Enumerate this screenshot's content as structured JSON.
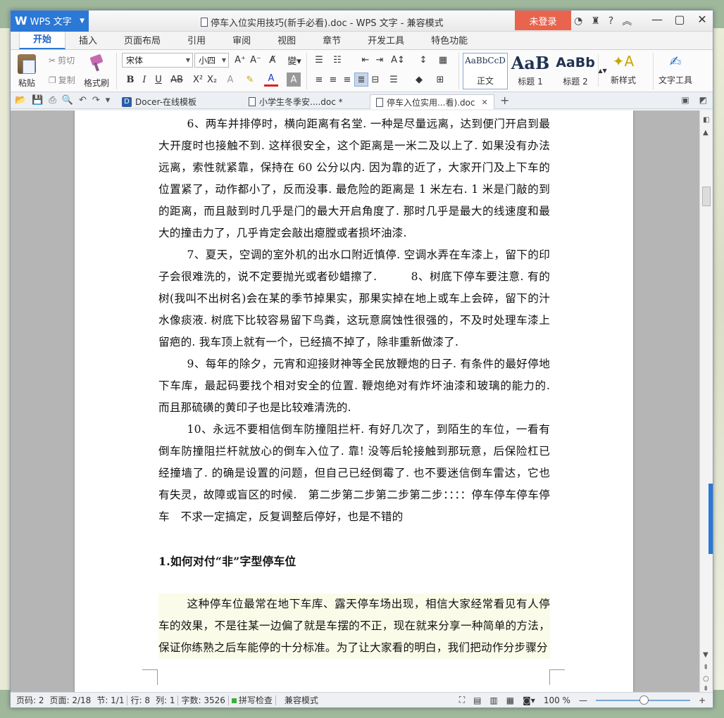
{
  "window": {
    "app_name": "WPS 文字",
    "title": "停车入位实用技巧(新手必看).doc - WPS 文字 - 兼容模式",
    "login_label": "未登录",
    "help_label": "?"
  },
  "ribbon_tabs": [
    "开始",
    "插入",
    "页面布局",
    "引用",
    "审阅",
    "视图",
    "章节",
    "开发工具",
    "特色功能"
  ],
  "ribbon": {
    "paste_label": "粘贴",
    "cut_label": "剪切",
    "copy_label": "复制",
    "format_painter_label": "格式刷",
    "font_name": "宋体",
    "font_size": "小四",
    "styles": [
      {
        "sample": "AaBbCcD",
        "name": "正文"
      },
      {
        "sample": "AaB",
        "name": "标题 1"
      },
      {
        "sample": "AaBb",
        "name": "标题 2"
      }
    ],
    "new_style_label": "新样式",
    "text_tools_label": "文字工具"
  },
  "doc_tabs": [
    {
      "label": "Docer-在线模板"
    },
    {
      "label": "小学生冬季安....doc *"
    },
    {
      "label": "停车入位实用...看).doc"
    }
  ],
  "document": {
    "paragraphs": [
      "6、两车并排停时，横向距离有名堂. 一种是尽量远离，达到便门开启到最大开度时也接触不到. 这样很安全，这个距离是一米二及以上了. 如果没有办法远离，索性就紧靠，保持在 60 公分以内. 因为靠的近了，大家开门及上下车的位置紧了，动作都小了，反而没事. 最危险的距离是 1 米左右. 1 米是门敲的到的距离，而且敲到时几乎是门的最大开启角度了. 那时几乎是最大的线速度和最大的撞击力了，几乎肯定会敲出瘪膛或者损坏油漆.",
      "7、夏天，空调的室外机的出水口附近慎停. 空调水弄在车漆上，留下的印子会很难洗的，说不定要抛光或者砂蜡擦了.　　　8、树底下停车要注意. 有的树(我叫不出树名)会在某的季节掉果实，那果实掉在地上或车上会碎，留下的汁水像痰液. 树底下比较容易留下鸟粪，这玩意腐蚀性很强的，不及时处理车漆上留疤的. 我车顶上就有一个，已经搞不掉了，除非重新做漆了.",
      "9、每年的除夕，元宵和迎接财神等全民放鞭炮的日子. 有条件的最好停地下车库，最起码要找个相对安全的位置. 鞭炮绝对有炸坏油漆和玻璃的能力的. 而且那硫磺的黄印子也是比较难清洗的.",
      "10、永远不要相信倒车防撞阻拦杆. 有好几次了，到陌生的车位，一看有倒车防撞阻拦杆就放心的倒车入位了. 靠! 没等后轮接触到那玩意，后保险杠已经撞墙了. 的确是设置的问题，但自己已经倒霉了. 也不要迷信倒车雷达，它也有失灵，故障或盲区的时候.　第二步第二步第二步第二步：：：：停车停车停车停车　不求一定搞定，反复调整后停好，也是不错的"
    ],
    "heading": "1.如何对付“非”字型停车位",
    "last_paragraph": "这种停车位最常在地下车库、露天停车场出现，相信大家经常看见有人停车的效果，不是往某一边偏了就是车摆的不正，现在就来分享一种简单的方法，保证你练熟之后车能停的十分标准。为了让大家看的明白，我们把动作分步骤分"
  },
  "status": {
    "page_no": "页码: 2",
    "pages": "页面: 2/18",
    "section": "节: 1/1",
    "row": "行: 8",
    "col": "列: 1",
    "word_count": "字数: 3526",
    "spell_check": "拼写检查",
    "mode": "兼容模式",
    "zoom": "100 %"
  },
  "colors": {
    "accent": "#2b78d6",
    "login_bg": "#e8644c"
  }
}
